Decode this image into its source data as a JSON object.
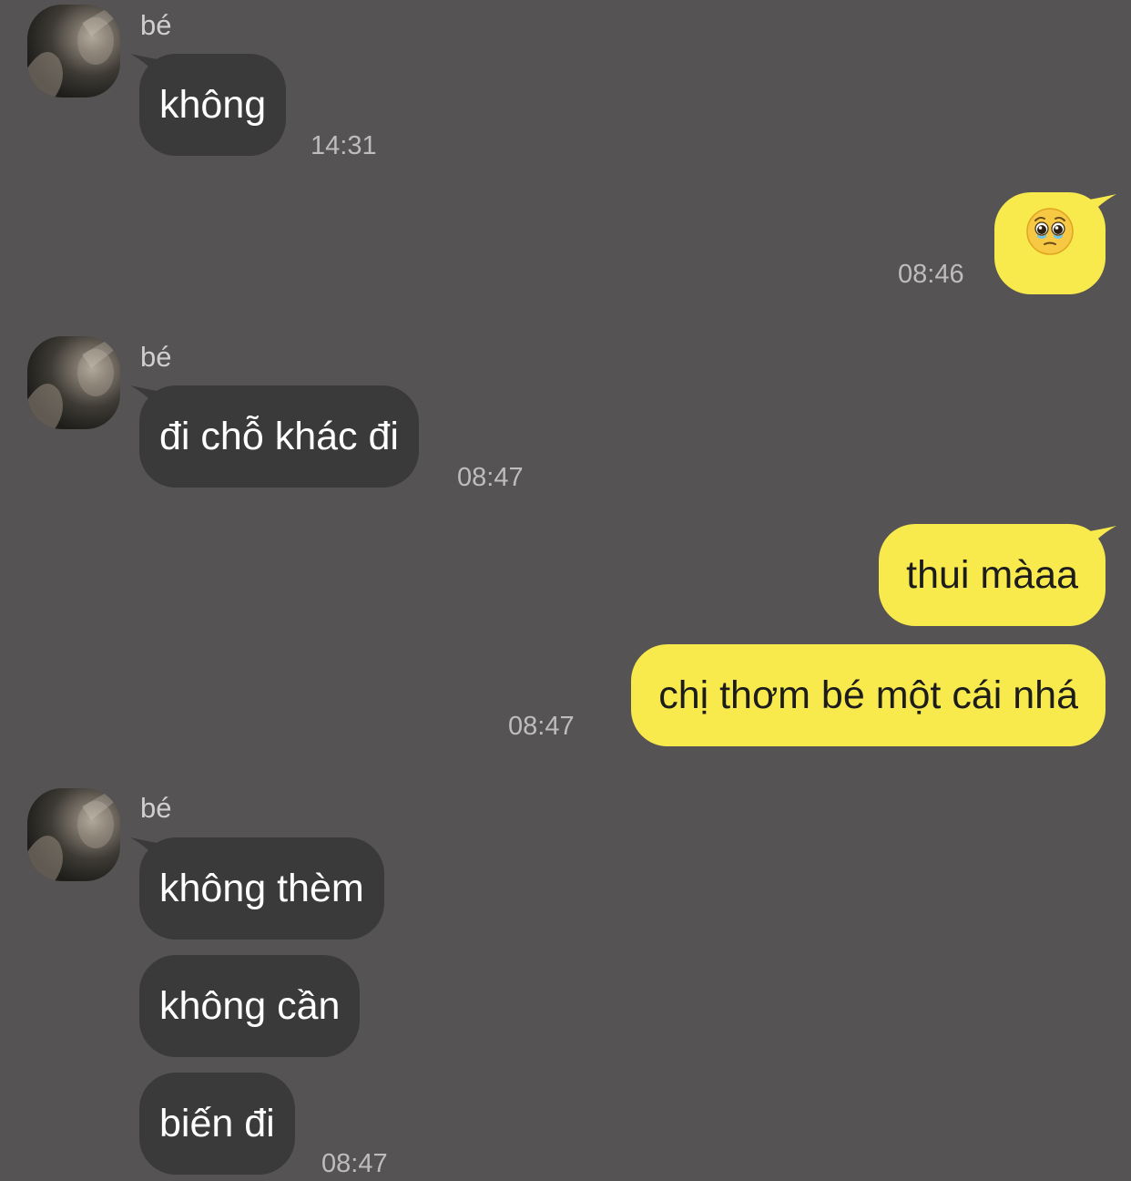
{
  "messages": [
    {
      "sender": "bé",
      "text": "không",
      "time": "14:31",
      "avatar_icon": "profile-photo"
    },
    {
      "sender": "me",
      "emoji": "pleading-face",
      "time": "08:46"
    },
    {
      "sender": "bé",
      "text": "đi chỗ khác đi",
      "time": "08:47",
      "avatar_icon": "profile-photo"
    },
    {
      "sender": "me",
      "text": "thui màaa"
    },
    {
      "sender": "me",
      "text": "chị thơm bé một cái nhá",
      "time": "08:47"
    },
    {
      "sender": "bé",
      "text": "không thèm",
      "avatar_icon": "profile-photo"
    },
    {
      "sender": "bé",
      "text": "không cần"
    },
    {
      "sender": "bé",
      "text": "biến đi",
      "time": "08:47"
    }
  ],
  "colors": {
    "background": "#555354",
    "incoming_bubble": "#3b3a3b",
    "outgoing_bubble": "#f8e94d",
    "timestamp": "#bdbdbd"
  }
}
